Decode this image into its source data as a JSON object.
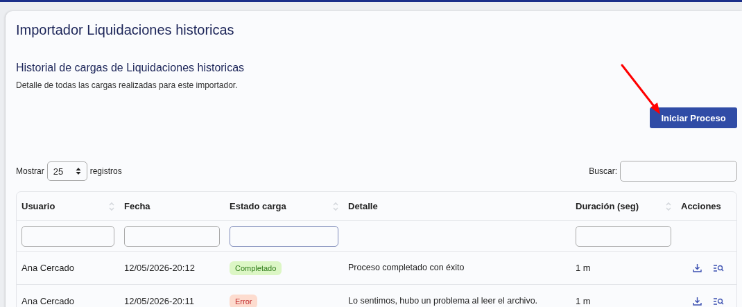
{
  "page": {
    "title": "Importador Liquidaciones historicas"
  },
  "section": {
    "title": "Historial de cargas de Liquidaciones historicas",
    "description": "Detalle de todas las cargas realizadas para este importador."
  },
  "start_button": "Iniciar Proceso",
  "length_control": {
    "before": "Mostrar",
    "value": "25",
    "after": "registros"
  },
  "search": {
    "label": "Buscar:"
  },
  "table": {
    "columns": [
      {
        "label": "Usuario",
        "sortable": true,
        "filter": {
          "focused": false
        }
      },
      {
        "label": "Fecha",
        "sortable": false,
        "filter": {
          "focused": false
        }
      },
      {
        "label": "Estado carga",
        "sortable": true,
        "filter": {
          "focused": true
        }
      },
      {
        "label": "Detalle",
        "sortable": false
      },
      {
        "label": "Duración (seg)",
        "sortable": true,
        "filter": {
          "focused": false
        }
      },
      {
        "label": "Acciones",
        "sortable": false
      }
    ],
    "rows": [
      {
        "user": "Ana Cercado",
        "date": "12/05/2026-20:12",
        "status": {
          "label": "Completado",
          "kind": "success"
        },
        "detail": "Proceso completado con éxito",
        "duration": "1 m"
      },
      {
        "user": "Ana Cercado",
        "date": "12/05/2026-20:11",
        "status": {
          "label": "Error",
          "kind": "error"
        },
        "detail": "Lo sentimos, hubo un problema al leer el archivo.",
        "duration": "1 m"
      }
    ]
  }
}
